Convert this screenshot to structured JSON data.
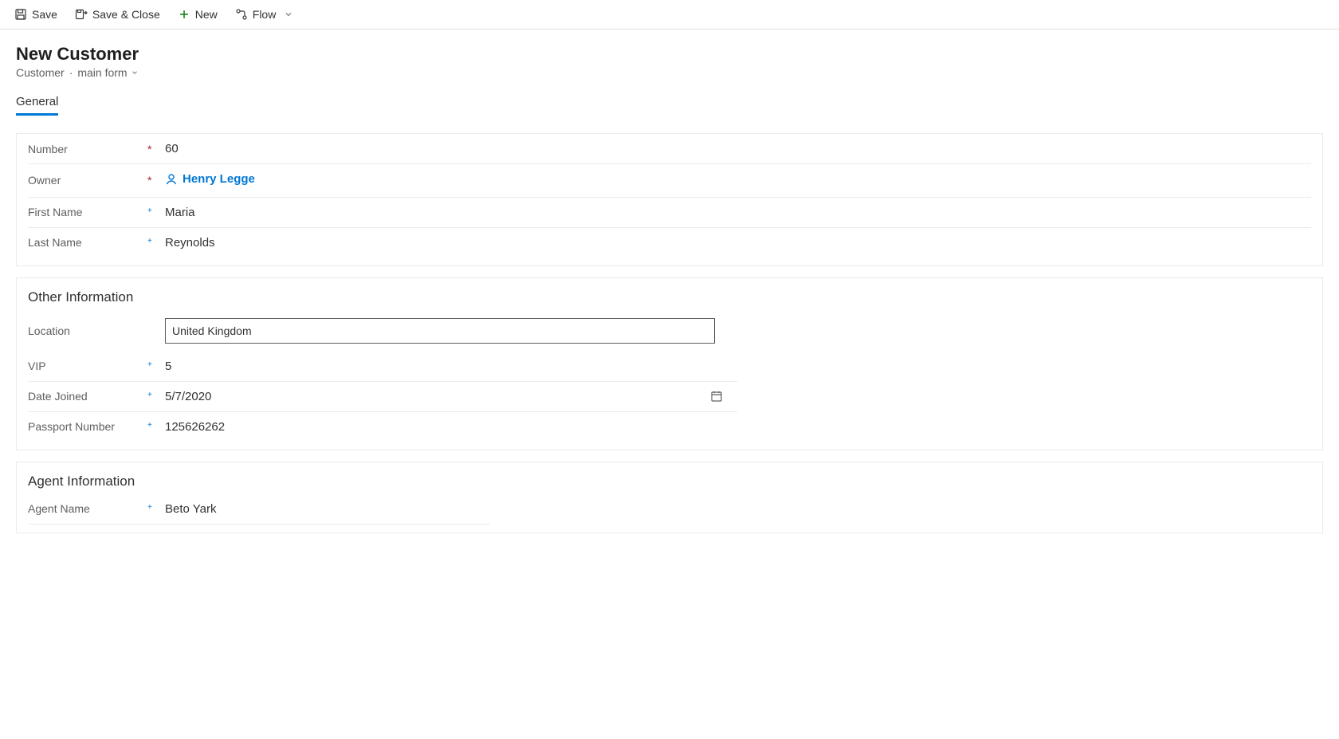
{
  "toolbar": {
    "save": "Save",
    "save_close": "Save & Close",
    "new": "New",
    "flow": "Flow"
  },
  "header": {
    "title": "New Customer",
    "entity": "Customer",
    "form_name": "main form"
  },
  "tabs": {
    "general": "General"
  },
  "sections": {
    "other_info": "Other Information",
    "agent_info": "Agent Information"
  },
  "fields": {
    "number": {
      "label": "Number",
      "value": "60"
    },
    "owner": {
      "label": "Owner",
      "value": "Henry Legge"
    },
    "first_name": {
      "label": "First Name",
      "value": "Maria"
    },
    "last_name": {
      "label": "Last Name",
      "value": "Reynolds"
    },
    "location": {
      "label": "Location",
      "value": "United Kingdom"
    },
    "vip": {
      "label": "VIP",
      "value": "5"
    },
    "date_joined": {
      "label": "Date Joined",
      "value": "5/7/2020"
    },
    "passport": {
      "label": "Passport Number",
      "value": "125626262"
    },
    "agent_name": {
      "label": "Agent Name",
      "value": "Beto Yark"
    }
  }
}
